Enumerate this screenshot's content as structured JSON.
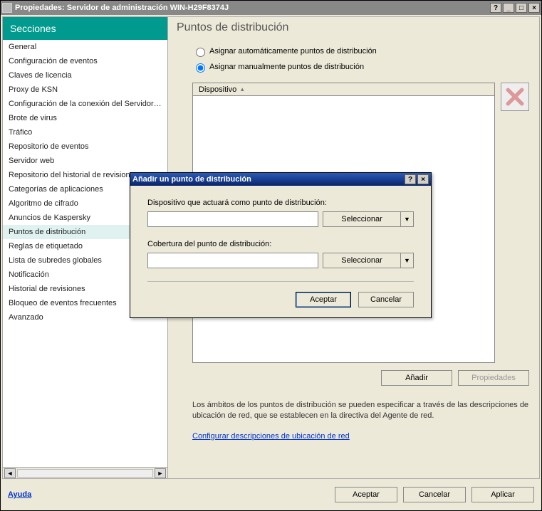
{
  "window": {
    "title": "Propiedades: Servidor de administración WIN-H29F8374J",
    "help_btn": "?",
    "min_btn": "_",
    "max_btn": "□",
    "close_btn": "×"
  },
  "sidebar": {
    "header": "Secciones",
    "items": [
      "General",
      "Configuración de eventos",
      "Claves de licencia",
      "Proxy de KSN",
      "Configuración de la conexión del Servidor de administración",
      "Brote de virus",
      "Tráfico",
      "Repositorio de eventos",
      "Servidor web",
      "Repositorio del historial de revisiones",
      "Categorías de aplicaciones",
      "Algoritmo de cifrado",
      "Anuncios de Kaspersky",
      "Puntos de distribución",
      "Reglas de etiquetado",
      "Lista de subredes globales",
      "Notificación",
      "Historial de revisiones",
      "Bloqueo de eventos frecuentes",
      "Avanzado"
    ],
    "selected_index": 13
  },
  "content": {
    "title": "Puntos de distribución",
    "radio_auto": "Asignar automáticamente puntos de distribución",
    "radio_manual": "Asignar manualmente puntos de distribución",
    "radio_selected": "manual",
    "grid": {
      "column": "Dispositivo",
      "sort_indicator": "▲"
    },
    "buttons": {
      "add": "Añadir",
      "properties": "Propiedades"
    },
    "info": "Los ámbitos de los puntos de distribución se pueden especificar a través de las descripciones de ubicación de red, que se establecen en la directiva del Agente de red.",
    "link": "Configurar descripciones de ubicación de red"
  },
  "dialog": {
    "title": "Añadir un punto de distribución",
    "help_btn": "?",
    "close_btn": "×",
    "label_device": "Dispositivo que actuará como punto de distribución:",
    "label_scope": "Cobertura del punto de distribución:",
    "device_value": "",
    "scope_value": "",
    "select_btn": "Seleccionar",
    "drop_icon": "▼",
    "ok": "Aceptar",
    "cancel": "Cancelar"
  },
  "footer": {
    "help": "Ayuda",
    "ok": "Aceptar",
    "cancel": "Cancelar",
    "apply": "Aplicar"
  }
}
